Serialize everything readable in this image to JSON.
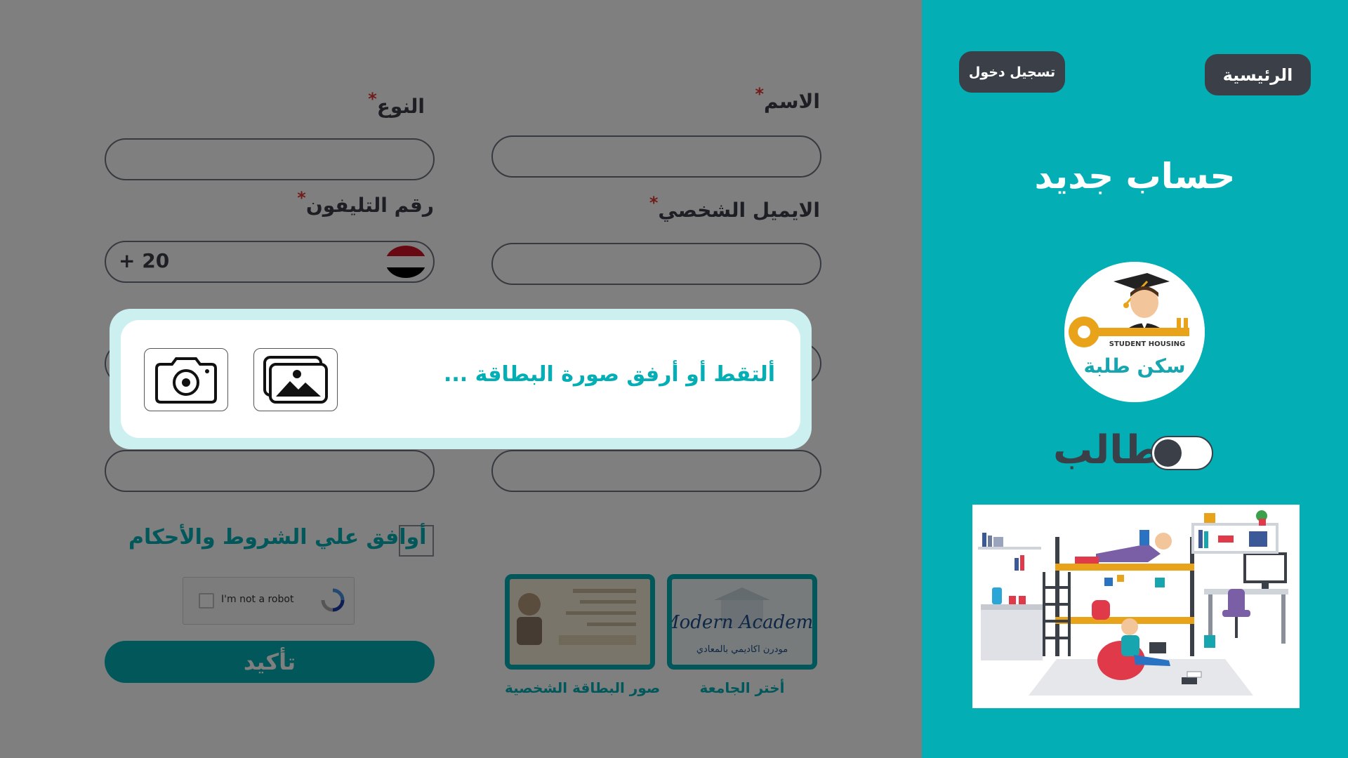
{
  "nav": {
    "home_label": "الرئيسية",
    "login_label": "تسجيل دخول"
  },
  "side": {
    "title": "حساب جديد",
    "logo_text_en": "STUDENT HOUSING",
    "logo_text_ar": "سكن طلبة",
    "role_label": "طالب",
    "role_toggle_on": false
  },
  "form": {
    "name_label": "الاسم",
    "gender_label": "النوع",
    "email_label": "الايميل  الشخصي",
    "phone_label": "رقم التليفون",
    "phone_prefix": "+ 20",
    "terms_label": "أوافق علي الشروط والأحكام",
    "captcha_text": "I'm not a robot",
    "submit_label": "تأكيد",
    "id_images_caption": "صور البطاقة الشخصية",
    "university_caption": "أختر الجامعة",
    "university_thumb_text": "Modern Academy",
    "university_thumb_text_ar": "مودرن اكاديمي بالمعادي"
  },
  "modal": {
    "prompt": "ألتقط أو أرفق صورة البطاقة ...",
    "gallery_icon": "gallery-icon",
    "camera_icon": "camera-icon"
  },
  "colors": {
    "accent": "#03aeb5",
    "dark": "#3a3f48",
    "required": "#e53935"
  }
}
